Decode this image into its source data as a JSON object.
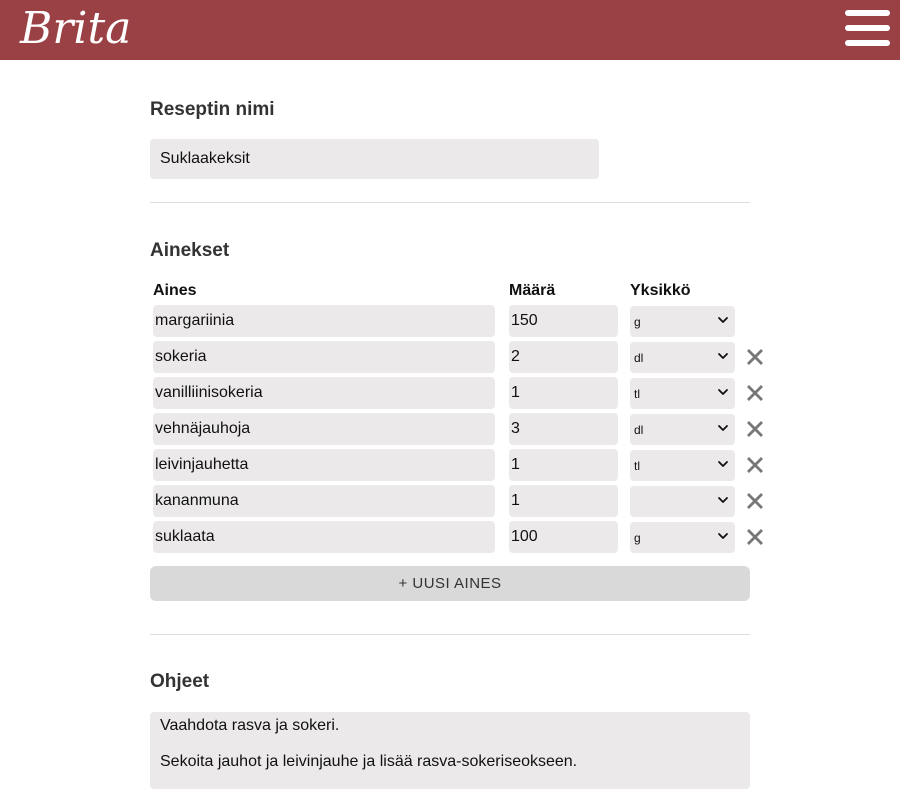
{
  "header": {
    "logo_text": "Brita",
    "brand_color": "#9a4145",
    "menu_icon": "hamburger-menu-icon"
  },
  "recipe_name": {
    "heading": "Reseptin nimi",
    "value": "Suklaakeksit"
  },
  "ingredients": {
    "heading": "Ainekset",
    "columns": {
      "name": "Aines",
      "amount": "Määrä",
      "unit": "Yksikkö"
    },
    "rows": [
      {
        "name": "margariinia",
        "amount": "150",
        "unit": "g",
        "removable": false
      },
      {
        "name": "sokeria",
        "amount": "2",
        "unit": "dl",
        "removable": true
      },
      {
        "name": "vanilliinisokeria",
        "amount": "1",
        "unit": "tl",
        "removable": true
      },
      {
        "name": "vehnäjauhoja",
        "amount": "3",
        "unit": "dl",
        "removable": true
      },
      {
        "name": "leivinjauhetta",
        "amount": "1",
        "unit": "tl",
        "removable": true
      },
      {
        "name": "kananmuna",
        "amount": "1",
        "unit": "",
        "removable": true
      },
      {
        "name": "suklaata",
        "amount": "100",
        "unit": "g",
        "removable": true
      }
    ],
    "add_button_label": "+ UUSI AINES"
  },
  "instructions": {
    "heading": "Ohjeet",
    "lines": [
      "Vaahdota rasva ja sokeri.",
      "Sekoita jauhot ja leivinjauhe ja lisää rasva-sokeriseokseen."
    ]
  }
}
